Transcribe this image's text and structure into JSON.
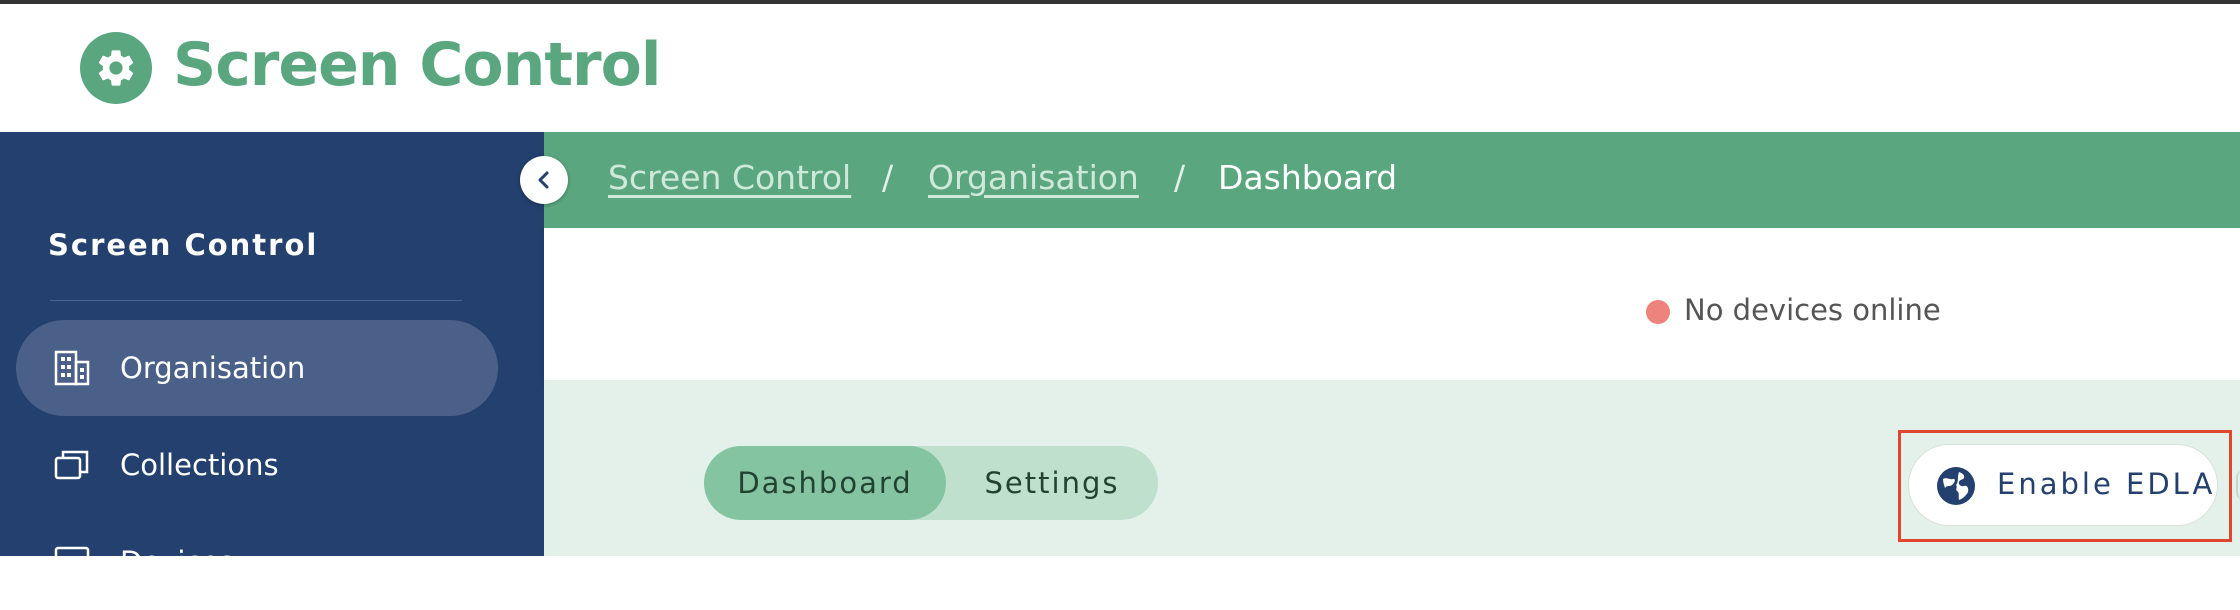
{
  "app": {
    "title": "Screen Control",
    "logo_icon": "gear-icon",
    "brand_color": "#5aa77f"
  },
  "sidebar": {
    "title": "Screen Control",
    "collapse_icon": "chevron-left-icon",
    "items": [
      {
        "label": "Organisation",
        "icon": "building-icon",
        "active": true
      },
      {
        "label": "Collections",
        "icon": "collections-icon",
        "active": false
      },
      {
        "label": "Devices",
        "icon": "device-icon",
        "active": false
      }
    ]
  },
  "breadcrumb": {
    "items": [
      {
        "label": "Screen Control",
        "link": true
      },
      {
        "label": "Organisation",
        "link": true
      },
      {
        "label": "Dashboard",
        "link": false
      }
    ],
    "separator": "/"
  },
  "status": {
    "text": "No devices online",
    "dot_color": "#ee837b"
  },
  "tabs": [
    {
      "label": "Dashboard",
      "active": true
    },
    {
      "label": "Settings",
      "active": false
    }
  ],
  "actions": {
    "enable_edla": "Enable EDLA",
    "enable_edla_icon": "globe-icon",
    "highlight_color": "#e0452f"
  }
}
